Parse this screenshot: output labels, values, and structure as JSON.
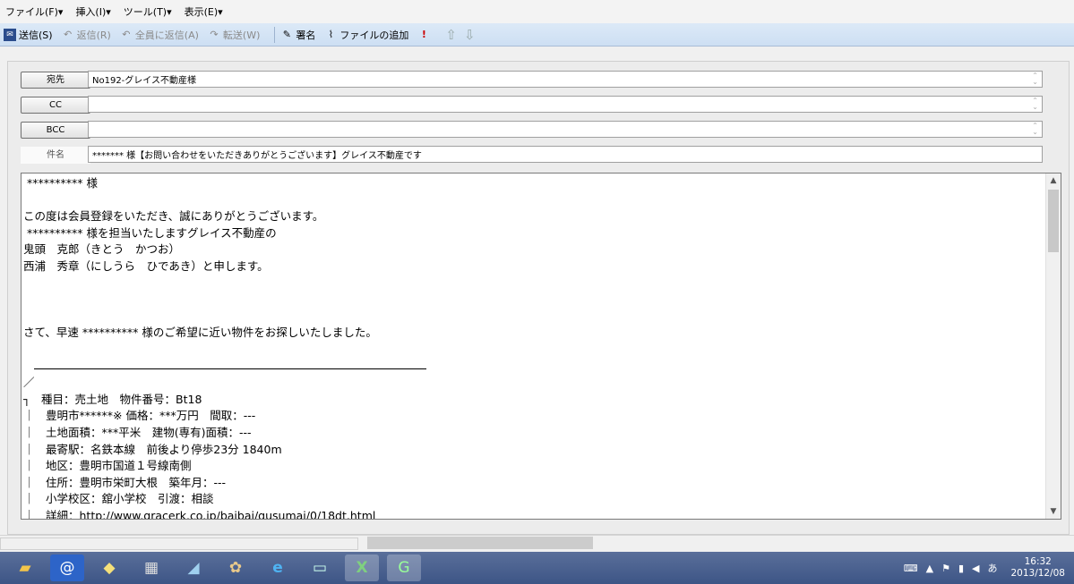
{
  "menu": [
    "ファイル(F)▾",
    "挿入(I)▾",
    "ツール(T)▾",
    "表示(E)▾"
  ],
  "toolbar": {
    "send": "送信(S)",
    "reply": "返信(R)",
    "reply_all": "全員に返信(A)",
    "forward": "転送(W)",
    "signature": "署名",
    "attach": "ファイルの追加"
  },
  "fields": {
    "to_label": "宛先",
    "to_value": "No192-グレイス不動産様",
    "cc_label": "CC",
    "cc_value": "",
    "bcc_label": "BCC",
    "bcc_value": "",
    "subject_label": "件名",
    "subject_value": "******* 様【お問い合わせをいただきありがとうございます】グレイス不動産です"
  },
  "body": {
    "lines": [
      " ********** 様",
      "",
      "この度は会員登録をいただき、誠にありがとうございます。",
      " ********** 様を担当いたしますグレイス不動産の",
      "鬼頭　克郎（きとう　かつお）",
      "西浦　秀章（にしうら　ひであき）と申します。",
      "",
      "",
      "",
      "さて、早速 ********** 様のご希望に近い物件をお探しいたしました。",
      "",
      "",
      "／",
      "┐　種目：売土地　物件番号：Bt18",
      "｜　豊明市******※ 価格：***万円　間取：---",
      "｜　土地面積：***平米　建物(専有)面積：---",
      "｜　最寄駅：名鉄本線　前後より停歩23分 1840m",
      "｜　地区：豊明市国道１号線南側",
      "｜　住所：豊明市栄町大根　築年月：---",
      "｜　小学校区：舘小学校　引渡：相談",
      "｜　詳細：http://www.gracerk.co.jp/baibai/gusumai/0/18dt.html"
    ]
  },
  "clock": {
    "time": "16:32",
    "date": "2013/12/08"
  },
  "tray": {
    "ime": "あ"
  },
  "colors": {
    "toolbar_bg": "#cddff3",
    "taskbar_bg": "#3d5586"
  }
}
